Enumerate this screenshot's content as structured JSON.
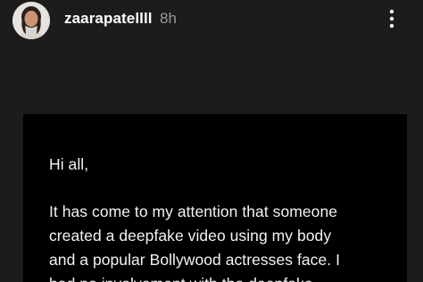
{
  "header": {
    "username": "zaarapatellll",
    "timestamp": "8h",
    "avatar_icon": "profile-photo",
    "more_icon": "vertical-ellipsis-icon"
  },
  "post": {
    "greeting": "Hi all,",
    "lines": [
      "It has come to my attention that someone",
      "created a deepfake video using my body",
      "and a popular Bollywood actresses face. I",
      "had no involvement with the deepfake"
    ]
  },
  "colors": {
    "background": "#1c1c1c",
    "card": "#000000",
    "text": "#f2f2f2",
    "muted": "#9a9a9a"
  }
}
